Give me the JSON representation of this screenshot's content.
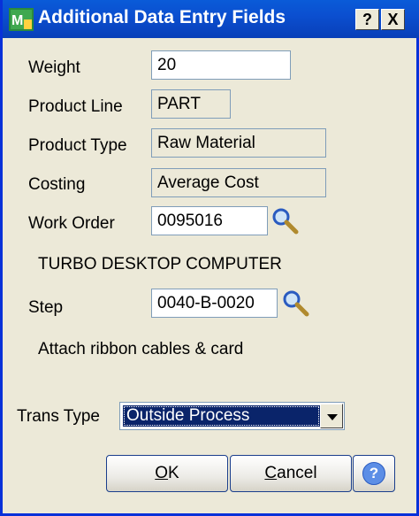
{
  "window": {
    "title": "Additional Data Entry Fields",
    "help_glyph": "?",
    "close_glyph": "X"
  },
  "fields": {
    "weight": {
      "label": "Weight",
      "value": "20"
    },
    "product_line": {
      "label": "Product Line",
      "value": "PART"
    },
    "product_type": {
      "label": "Product Type",
      "value": "Raw Material"
    },
    "costing": {
      "label": "Costing",
      "value": "Average Cost"
    },
    "work_order": {
      "label": "Work Order",
      "value": "0095016",
      "description": "TURBO DESKTOP COMPUTER"
    },
    "step": {
      "label": "Step",
      "value": "0040-B-0020",
      "description": "Attach ribbon cables & card"
    },
    "trans_type": {
      "label": "Trans Type",
      "selected": "Outside Process"
    }
  },
  "buttons": {
    "ok": {
      "label": "OK",
      "mnemonic": "O",
      "rest": "K"
    },
    "cancel": {
      "label": "Cancel",
      "mnemonic": "C",
      "rest": "ancel"
    },
    "help": {
      "glyph": "?"
    }
  },
  "icons": {
    "app": "app-icon",
    "lookup": "magnifier-icon",
    "help": "help-icon"
  },
  "colors": {
    "titlebar": "#0b4fd0",
    "selection": "#0a246a",
    "dialog_bg": "#ece9d8"
  }
}
